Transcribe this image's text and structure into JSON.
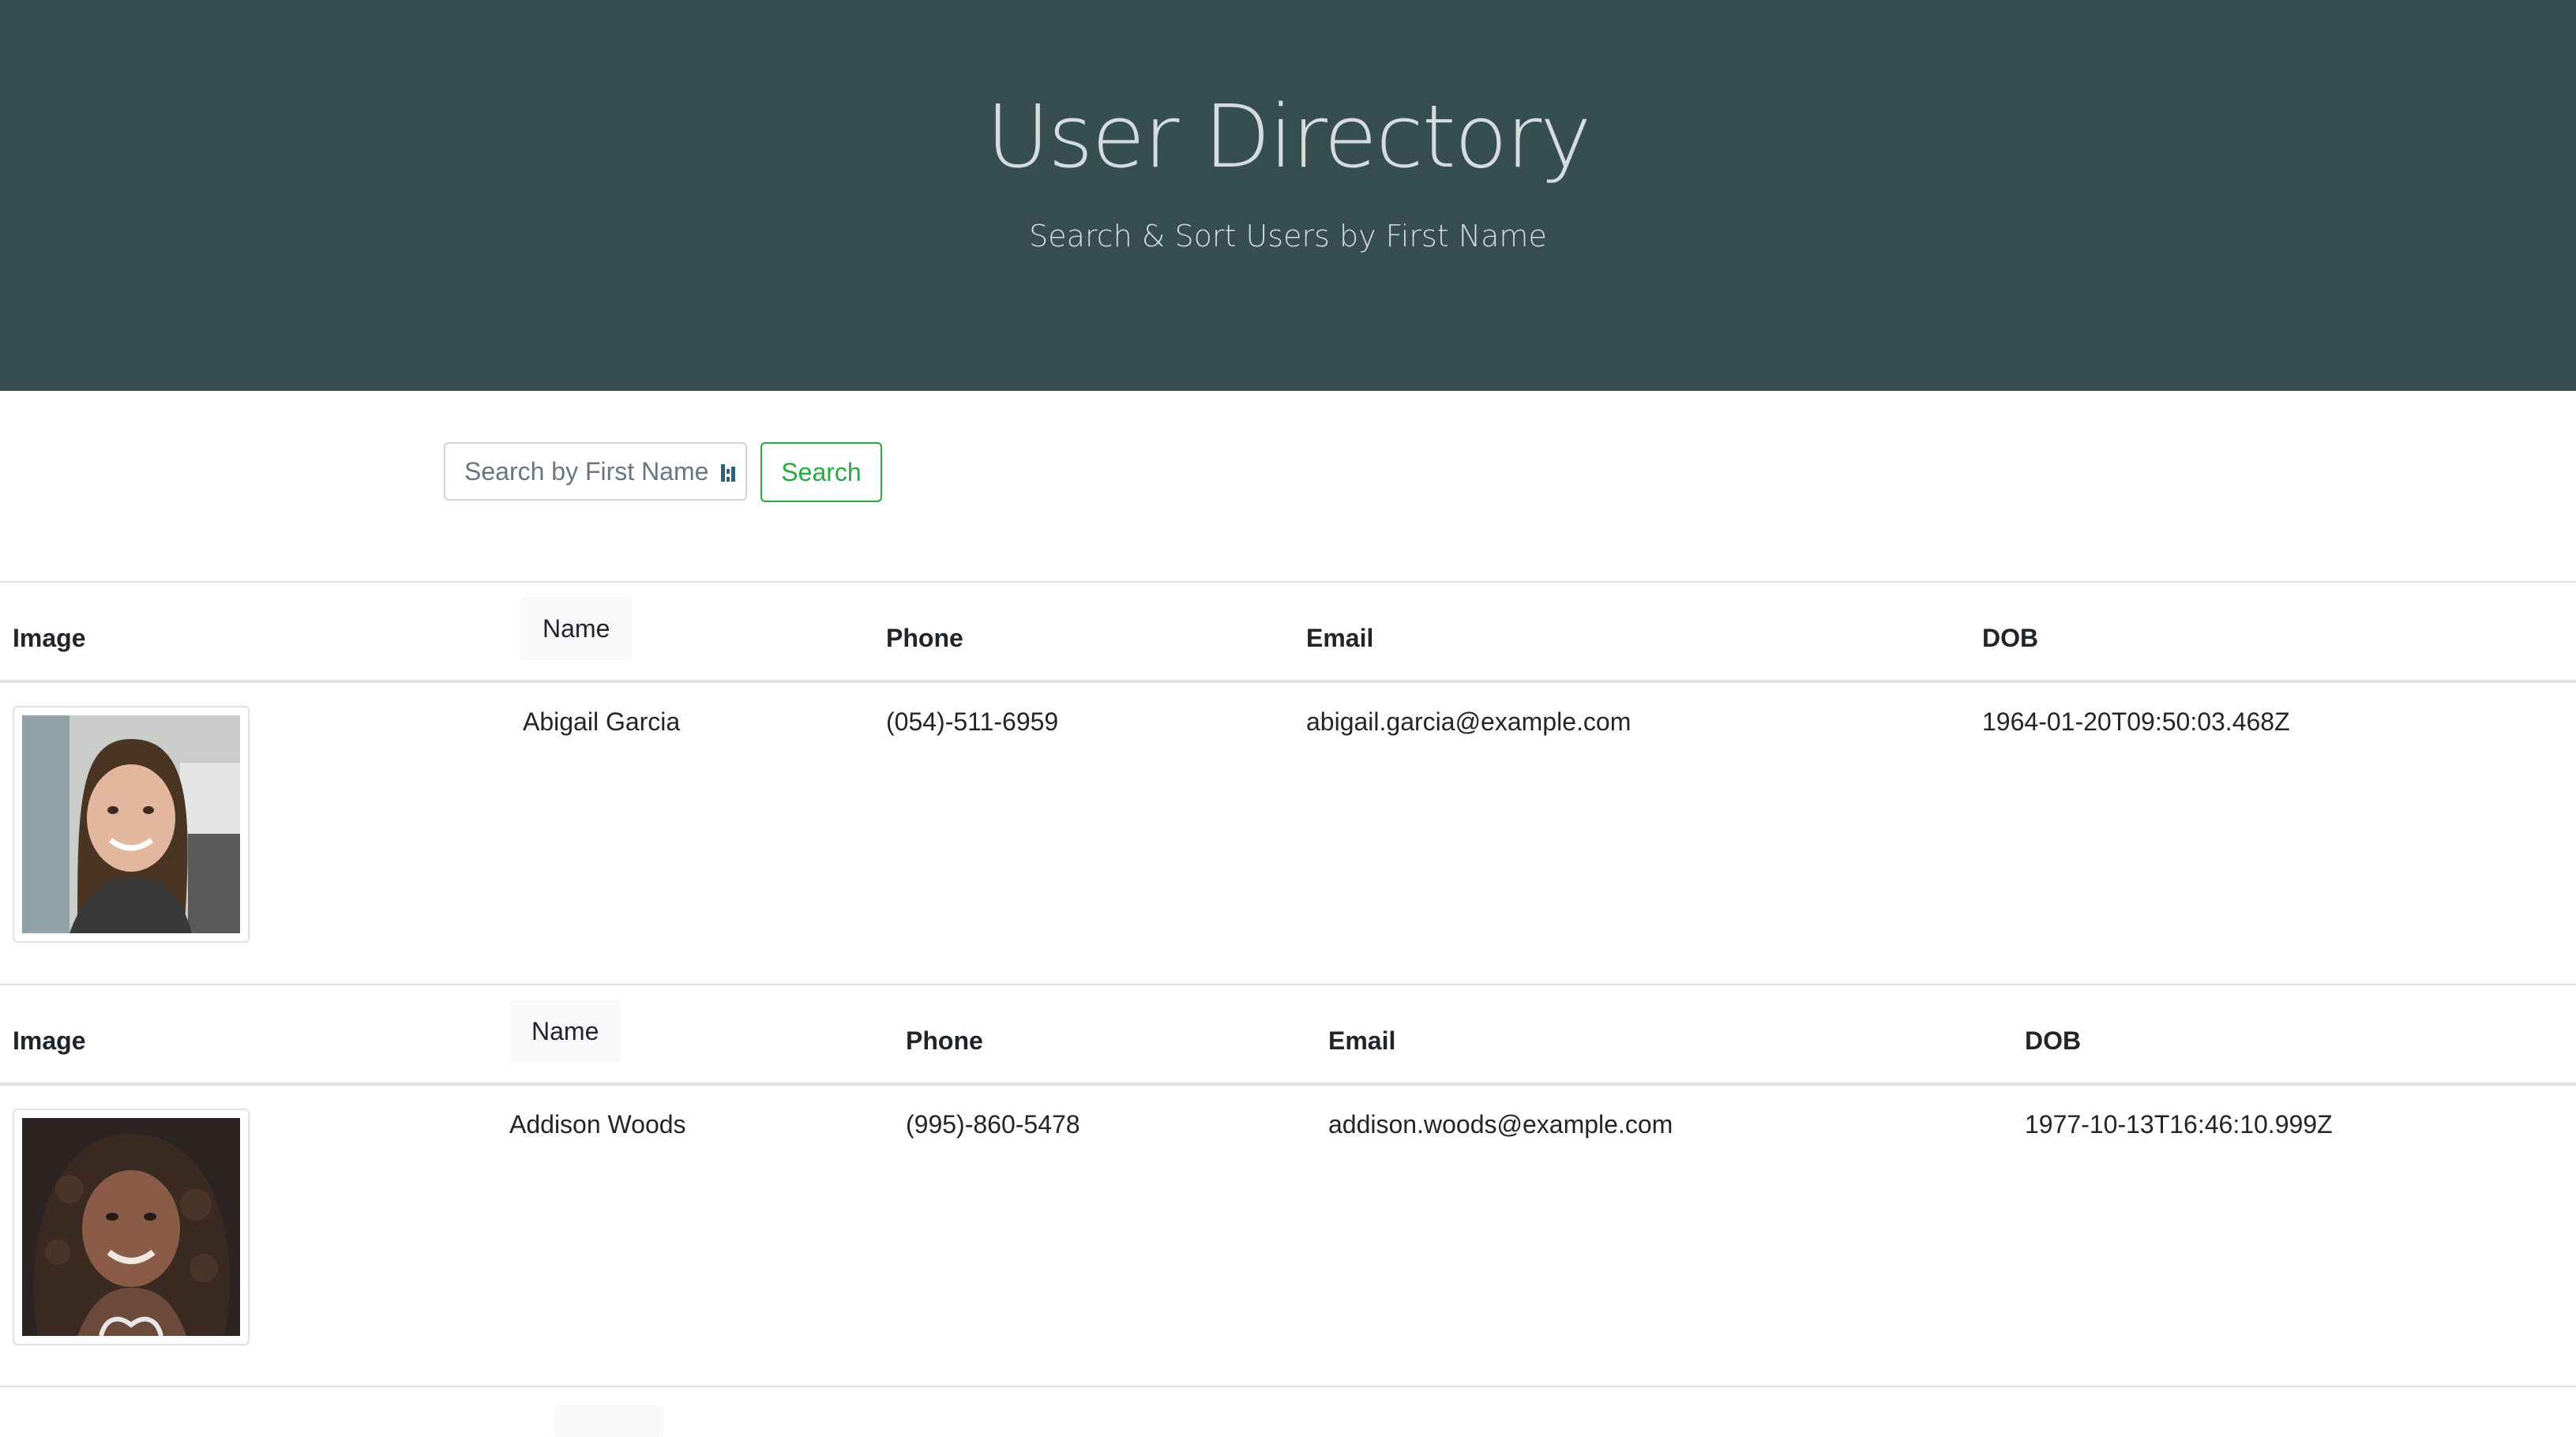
{
  "header": {
    "title": "User Directory",
    "subtitle": "Search & Sort Users by First Name"
  },
  "search": {
    "placeholder": "Search by First Name",
    "value": "",
    "button_label": "Search"
  },
  "table": {
    "columns": {
      "image": "Image",
      "name": "Name",
      "phone": "Phone",
      "email": "Email",
      "dob": "DOB"
    },
    "rows": [
      {
        "name": "Abigail Garcia",
        "phone": "(054)-511-6959",
        "email": "abigail.garcia@example.com",
        "dob": "1964-01-20T09:50:03.468Z"
      },
      {
        "name": "Addison Woods",
        "phone": "(995)-860-5478",
        "email": "addison.woods@example.com",
        "dob": "1977-10-13T16:46:10.999Z"
      }
    ]
  },
  "colors": {
    "header_bg": "#374e51",
    "header_text": "#d6dcdd",
    "accent_green": "#28a745",
    "border": "#dee2e6",
    "sort_button_bg": "#f8f9fa"
  },
  "icons": {
    "input_extension": "password-manager-icon",
    "avatar": "user-avatar-photo"
  }
}
